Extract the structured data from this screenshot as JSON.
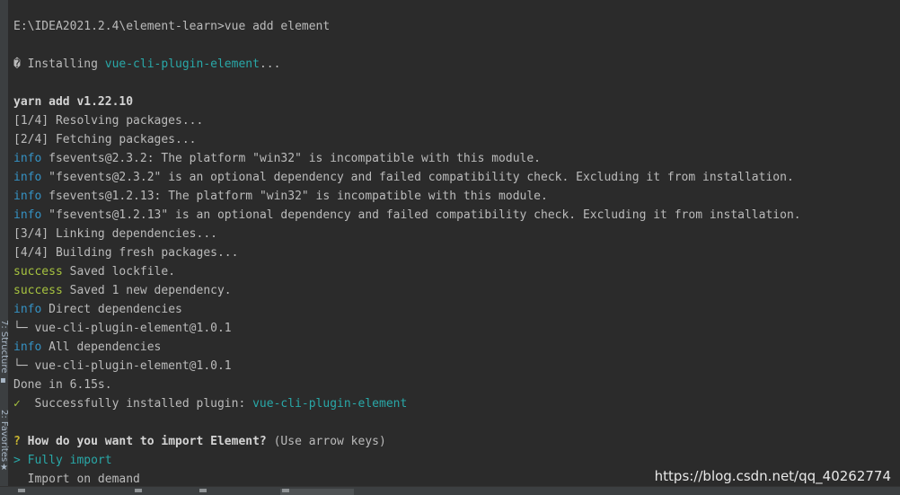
{
  "sidebar": {
    "structure_label": "7: Structure",
    "favorites_label": "2: Favorites",
    "structure_icon": "structure-icon",
    "favorites_icon": "star-icon"
  },
  "terminal": {
    "prompt_line": "E:\\IDEA2021.2.4\\element-learn>vue add element",
    "installing_prefix": "� Installing ",
    "installing_plugin": "vue-cli-plugin-element",
    "installing_suffix": "...",
    "yarn_header": "yarn add v1.22.10",
    "step1": "[1/4] Resolving packages...",
    "step2": "[2/4] Fetching packages...",
    "info_label": "info",
    "success_label": "success",
    "info1": " fsevents@2.3.2: The platform \"win32\" is incompatible with this module.",
    "info2": " \"fsevents@2.3.2\" is an optional dependency and failed compatibility check. Excluding it from installation.",
    "info3": " fsevents@1.2.13: The platform \"win32\" is incompatible with this module.",
    "info4": " \"fsevents@1.2.13\" is an optional dependency and failed compatibility check. Excluding it from installation.",
    "step3": "[3/4] Linking dependencies...",
    "step4": "[4/4] Building fresh packages...",
    "success1": " Saved lockfile.",
    "success2": " Saved 1 new dependency.",
    "info5": " Direct dependencies",
    "tree1": "└─ vue-cli-plugin-element@1.0.1",
    "info6": " All dependencies",
    "tree2": "└─ vue-cli-plugin-element@1.0.1",
    "done": "Done in 6.15s.",
    "check_mark": "✓",
    "installed_text": "  Successfully installed plugin: ",
    "installed_plugin": "vue-cli-plugin-element",
    "question_mark": "?",
    "question": " How do you want to import Element?",
    "question_hint": " (Use arrow keys)",
    "option_selected": "> Fully import",
    "option_other": "  Import on demand"
  },
  "watermark": "https://blog.csdn.net/qq_40262774",
  "colors": {
    "background": "#2b2b2b",
    "text": "#bbbbbb",
    "info": "#3592c4",
    "success": "#a6c23f",
    "cyan": "#29a8a8"
  }
}
